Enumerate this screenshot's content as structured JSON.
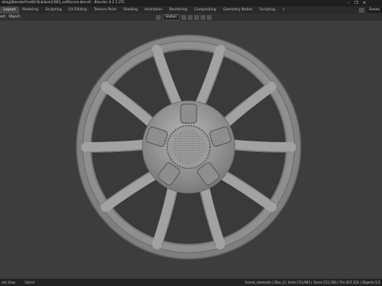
{
  "window": {
    "title": "rblog\\BlenderPro\\69.Rubikon\\C083_softScene.blend] - Blender 4.2.1 LTS",
    "controls": [
      "–",
      "❐",
      "✕"
    ]
  },
  "workspace_tabs": [
    "Layout",
    "Modeling",
    "Sculpting",
    "UV Editing",
    "Texture Paint",
    "Shading",
    "Animation",
    "Rendering",
    "Compositing",
    "Geometry Nodes",
    "Scripting",
    "+"
  ],
  "active_tab": "Layout",
  "scene_button": "Scene",
  "header": {
    "menus": [
      "ect",
      "Object"
    ],
    "transform_orientation": "Global"
  },
  "statusbar": {
    "left": [
      "ate View",
      "Select"
    ],
    "right": "Scene_elements | Disc_0 | Verts:153,983 | Faces:153,760 | Tris:307,520 | Objects:1/1"
  },
  "colors": {
    "viewport_bg": "#3d3d3d",
    "wheel_base": "#8c8c8c"
  }
}
